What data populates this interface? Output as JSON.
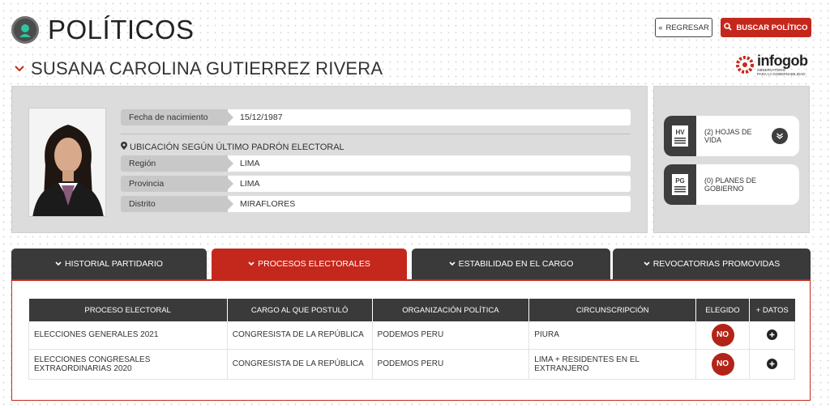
{
  "header": {
    "title": "POLÍTICOS",
    "person_name": "SUSANA CAROLINA GUTIERREZ RIVERA",
    "back_label": "REGRESAR",
    "search_label": "BUSCAR POLÍTICO",
    "brand_name": "infogob",
    "brand_subtitle_1": "OBSERVATORIO",
    "brand_subtitle_2": "PARA LA GOBERNABILIDAD"
  },
  "profile": {
    "birth_label": "Fecha de nacimiento",
    "birth_value": "15/12/1987",
    "location_heading": "UBICACIÓN SEGÚN ÚLTIMO PADRÓN ELECTORAL",
    "region_label": "Región",
    "region_value": "LIMA",
    "province_label": "Provincia",
    "province_value": "LIMA",
    "district_label": "Distrito",
    "district_value": "MIRAFLORES"
  },
  "documents": [
    {
      "icon_text": "HV",
      "label": "(2) HOJAS DE VIDA"
    },
    {
      "icon_text": "PG",
      "label": "(0) PLANES DE GOBIERNO"
    }
  ],
  "tabs": [
    {
      "label": "HISTORIAL PARTIDARIO",
      "active": false
    },
    {
      "label": "PROCESOS ELECTORALES",
      "active": true
    },
    {
      "label": "ESTABILIDAD EN EL CARGO",
      "active": false
    },
    {
      "label": "REVOCATORIAS PROMOVIDAS",
      "active": false
    }
  ],
  "table": {
    "headers": [
      "PROCESO ELECTORAL",
      "CARGO AL QUE POSTULÓ",
      "ORGANIZACIÓN POLÍTICA",
      "CIRCUNSCRIPCIÓN",
      "ELEGIDO",
      "+ DATOS"
    ],
    "rows": [
      {
        "proceso": "ELECCIONES GENERALES 2021",
        "cargo": "CONGRESISTA DE LA REPÚBLICA",
        "organizacion": "PODEMOS PERU",
        "circunscripcion": "PIURA",
        "elegido": "NO"
      },
      {
        "proceso": "ELECCIONES CONGRESALES EXTRAORDINARIAS 2020",
        "cargo": "CONGRESISTA DE LA REPÚBLICA",
        "organizacion": "PODEMOS PERU",
        "circunscripcion": "LIMA + RESIDENTES EN EL EXTRANJERO",
        "elegido": "NO"
      }
    ]
  },
  "colors": {
    "accent": "#c4281c",
    "dark": "#3a3a3a",
    "panel": "#dcdcdc"
  }
}
